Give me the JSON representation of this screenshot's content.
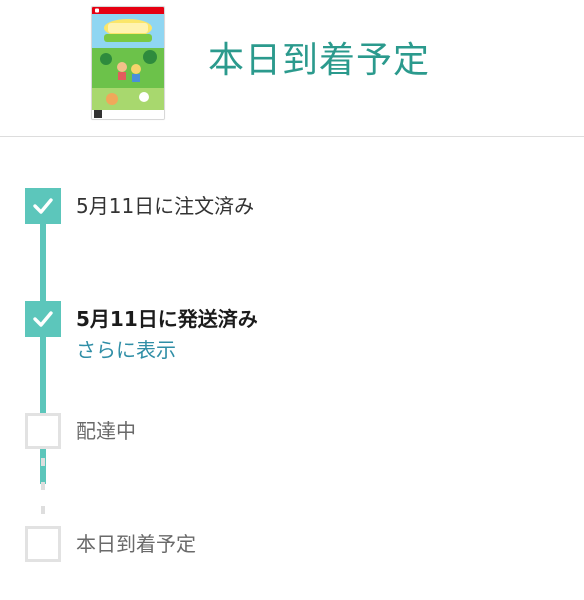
{
  "header": {
    "title": "本日到着予定",
    "product_image_icon": "game-box-art"
  },
  "timeline": {
    "steps": [
      {
        "label": "5月11日に注文済み",
        "status": "complete",
        "icon": "check-icon"
      },
      {
        "label": "5月11日に発送済み",
        "status": "complete",
        "icon": "check-icon",
        "link": "さらに表示"
      },
      {
        "label": "配達中",
        "status": "pending"
      },
      {
        "label": "本日到着予定",
        "status": "pending"
      }
    ]
  },
  "colors": {
    "accent": "#5cc6bb",
    "title": "#2b9a8d",
    "link": "#2f8ea6",
    "pending": "#e2e2e2"
  }
}
